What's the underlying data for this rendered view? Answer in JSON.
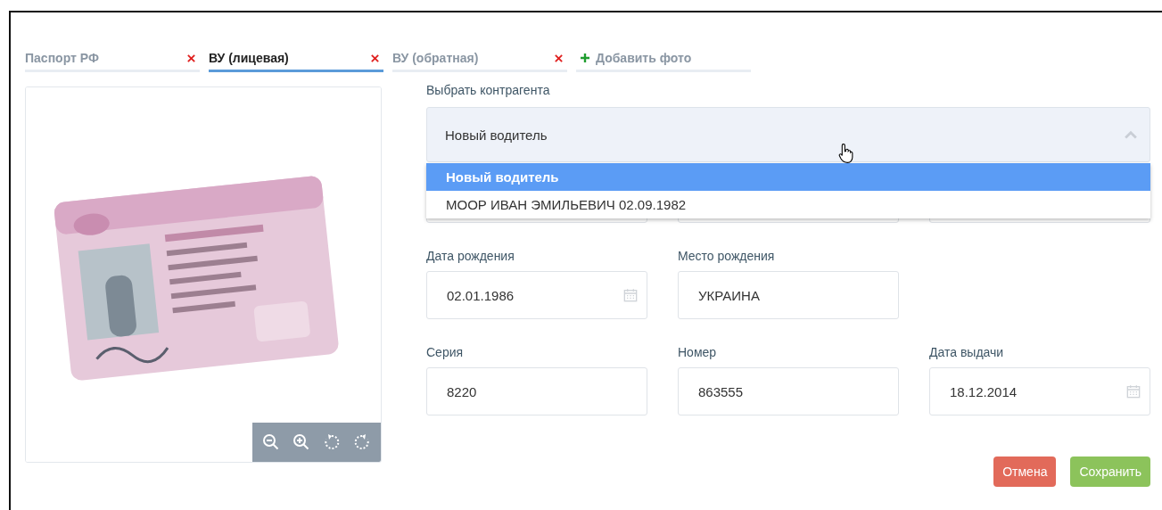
{
  "tabs": [
    {
      "label": "Паспорт РФ",
      "selected": false
    },
    {
      "label": "ВУ (лицевая)",
      "selected": true
    },
    {
      "label": "ВУ (обратная)",
      "selected": false
    },
    {
      "label": "Добавить фото",
      "selected": false,
      "kind": "add"
    }
  ],
  "counterparty": {
    "label": "Выбрать контрагента",
    "value": "Новый водитель",
    "expanded": true,
    "options": [
      {
        "label": "Новый водитель",
        "selected": true
      },
      {
        "label": "МООР ИВАН ЭМИЛЬЕВИЧ 02.09.1982",
        "selected": false
      }
    ]
  },
  "field_rows": [
    [
      {
        "kind": "text"
      },
      {
        "kind": "text"
      },
      {
        "kind": "text"
      }
    ],
    [
      {
        "kind": "date",
        "label": "Дата рождения",
        "value": "02.01.1986"
      },
      {
        "kind": "text",
        "label": "Место рождения",
        "value": "УКРАИНА"
      }
    ],
    [
      {
        "kind": "text",
        "label": "Серия",
        "value": "8220"
      },
      {
        "kind": "text",
        "label": "Номер",
        "value": "863555"
      },
      {
        "kind": "date",
        "label": "Дата выдачи",
        "value": "18.12.2014"
      }
    ]
  ],
  "buttons": [
    {
      "label": "Отмена",
      "kind": "cancel"
    },
    {
      "label": "Сохранить",
      "kind": "save"
    }
  ]
}
